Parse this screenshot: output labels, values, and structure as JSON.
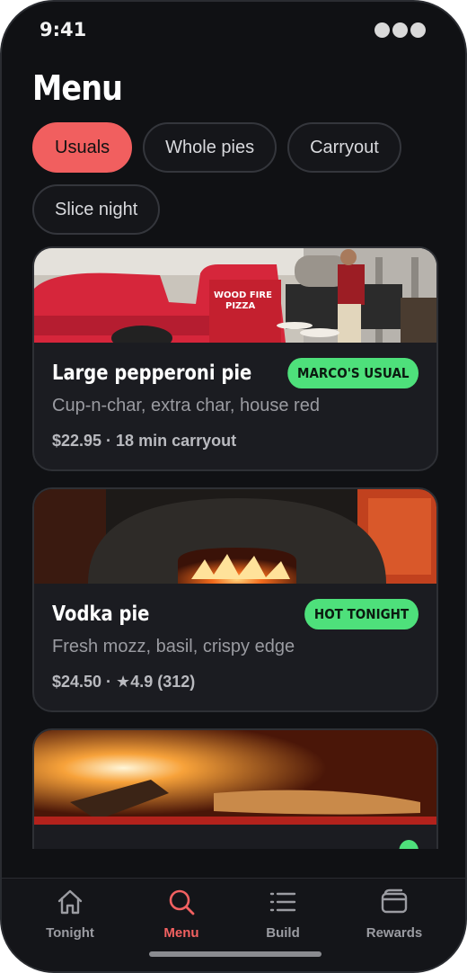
{
  "status_bar": {
    "time": "9:41"
  },
  "page": {
    "title": "Menu"
  },
  "chips": [
    {
      "label": "Usuals",
      "active": true
    },
    {
      "label": "Whole pies",
      "active": false
    },
    {
      "label": "Carryout",
      "active": false
    },
    {
      "label": "Slice night",
      "active": false
    }
  ],
  "cards": [
    {
      "title": "Large pepperoni pie",
      "badge": "MARCO'S USUAL",
      "description": "Cup-n-char, extra char, house red",
      "meta": "$22.95 · 18 min carryout",
      "image": "food-truck-photo"
    },
    {
      "title": "Vodka pie",
      "badge": "HOT TONIGHT",
      "description": "Fresh mozz, basil, crispy edge",
      "meta": "$24.50 · ★4.9 (312)",
      "image": "wood-oven-photo"
    },
    {
      "title": "",
      "badge": "",
      "description": "",
      "meta": "",
      "image": "oven-fire-photo"
    }
  ],
  "tabbar": {
    "tabs": [
      {
        "label": "Tonight",
        "icon": "home-icon",
        "active": false
      },
      {
        "label": "Menu",
        "icon": "search-icon",
        "active": true
      },
      {
        "label": "Build",
        "icon": "list-icon",
        "active": false
      },
      {
        "label": "Rewards",
        "icon": "wallet-icon",
        "active": false
      }
    ]
  },
  "colors": {
    "accent": "#f15f5f",
    "badge": "#4ee07b",
    "background": "#101114",
    "card": "#1b1c21"
  }
}
